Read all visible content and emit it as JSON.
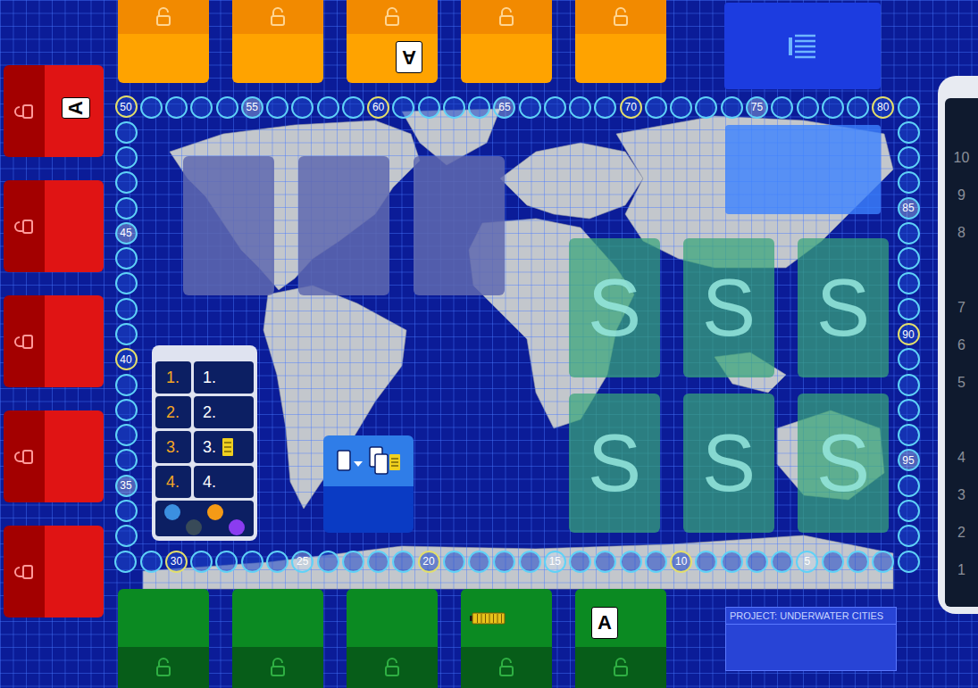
{
  "board": {
    "title": "PROJECT: UNDERWATER CITIES"
  },
  "top_cards": [
    {
      "locked": true,
      "marker": ""
    },
    {
      "locked": true,
      "marker": ""
    },
    {
      "locked": true,
      "marker": "A"
    },
    {
      "locked": true,
      "marker": ""
    },
    {
      "locked": true,
      "marker": ""
    }
  ],
  "left_cards": [
    {
      "locked": true,
      "marker": "A"
    },
    {
      "locked": true,
      "marker": ""
    },
    {
      "locked": true,
      "marker": ""
    },
    {
      "locked": true,
      "marker": ""
    },
    {
      "locked": true,
      "marker": ""
    }
  ],
  "bottom_cards": [
    {
      "locked": true,
      "marker": "",
      "battery": false
    },
    {
      "locked": true,
      "marker": "",
      "battery": false
    },
    {
      "locked": true,
      "marker": "",
      "battery": false
    },
    {
      "locked": true,
      "marker": "",
      "battery": true
    },
    {
      "locked": true,
      "marker": "A",
      "battery": false
    }
  ],
  "score_track": {
    "marks": [
      {
        "label": "5",
        "major": false
      },
      {
        "label": "10",
        "major": true
      },
      {
        "label": "15",
        "major": false
      },
      {
        "label": "20",
        "major": true
      },
      {
        "label": "25",
        "major": false
      },
      {
        "label": "30",
        "major": true
      },
      {
        "label": "35",
        "major": false
      },
      {
        "label": "40",
        "major": true
      },
      {
        "label": "45",
        "major": false
      },
      {
        "label": "50",
        "major": true
      },
      {
        "label": "55",
        "major": false
      },
      {
        "label": "60",
        "major": true
      },
      {
        "label": "65",
        "major": false
      },
      {
        "label": "70",
        "major": true
      },
      {
        "label": "75",
        "major": false
      },
      {
        "label": "80",
        "major": true
      },
      {
        "label": "85",
        "major": false
      },
      {
        "label": "90",
        "major": true
      },
      {
        "label": "95",
        "major": false
      }
    ]
  },
  "empty_slots": [
    {
      "filled": false
    },
    {
      "filled": false
    },
    {
      "filled": false
    }
  ],
  "s_cards": [
    {
      "label": "S"
    },
    {
      "label": "S"
    },
    {
      "label": "S"
    },
    {
      "label": "S"
    },
    {
      "label": "S"
    },
    {
      "label": "S"
    }
  ],
  "legend": {
    "rows": [
      {
        "rank": "1.",
        "points": "1.",
        "bonus": false
      },
      {
        "rank": "2.",
        "points": "2.",
        "bonus": false
      },
      {
        "rank": "3.",
        "points": "3.",
        "bonus": true
      },
      {
        "rank": "4.",
        "points": "4.",
        "bonus": false
      }
    ],
    "dots": [
      {
        "color": "#3b8fe0"
      },
      {
        "color": "#384a58"
      },
      {
        "color": "#f59a16"
      },
      {
        "color": "#8b3cf0"
      }
    ]
  },
  "side_track": {
    "rows": [
      {
        "kind": "number",
        "label": "10"
      },
      {
        "kind": "number",
        "label": "9"
      },
      {
        "kind": "number",
        "label": "8"
      },
      {
        "kind": "gap"
      },
      {
        "kind": "number",
        "label": "7"
      },
      {
        "kind": "number",
        "label": "6"
      },
      {
        "kind": "number",
        "label": "5"
      },
      {
        "kind": "gap"
      },
      {
        "kind": "number",
        "label": "4"
      },
      {
        "kind": "number",
        "label": "3"
      },
      {
        "kind": "number",
        "label": "2"
      },
      {
        "kind": "number",
        "label": "1"
      }
    ]
  }
}
